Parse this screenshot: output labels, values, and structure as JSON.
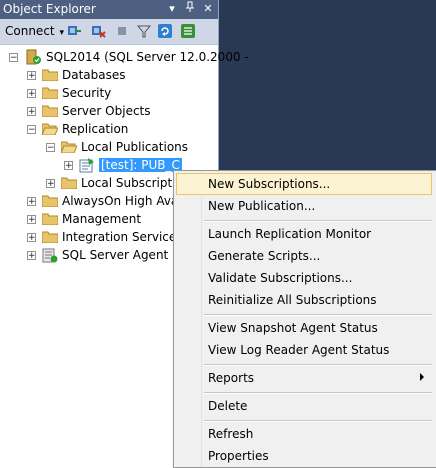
{
  "panel": {
    "title": "Object Explorer",
    "pin_icon": "pin-icon",
    "close_icon": "close-icon"
  },
  "toolbar": {
    "connect_label": "Connect",
    "icons": [
      "connect-server-icon",
      "disconnect-icon",
      "stop-icon",
      "filter-icon",
      "refresh-icon",
      "summary-icon"
    ]
  },
  "tree": {
    "server": "SQL2014 (SQL Server 12.0.2000 -",
    "databases": "Databases",
    "security": "Security",
    "server_objects": "Server Objects",
    "replication": "Replication",
    "local_publications": "Local Publications",
    "publication": "[test]: PUB_C",
    "local_subscriptions": "Local Subscriptio",
    "alwayson": "AlwaysOn High Avai",
    "management": "Management",
    "integration_services": "Integration Services C",
    "sql_server_agent": "SQL Server Agent"
  },
  "context_menu": {
    "new_subscriptions": "New Subscriptions...",
    "new_publication": "New Publication...",
    "launch_replication_monitor": "Launch Replication Monitor",
    "generate_scripts": "Generate Scripts...",
    "validate_subscriptions": "Validate Subscriptions...",
    "reinitialize_all": "Reinitialize All Subscriptions",
    "view_snapshot_agent": "View Snapshot Agent Status",
    "view_log_reader_agent": "View Log Reader Agent Status",
    "reports": "Reports",
    "delete": "Delete",
    "refresh": "Refresh",
    "properties": "Properties"
  },
  "colors": {
    "selection": "#3399ff",
    "menu_hover": "#fbf3d1",
    "title_bar": "#4d6082"
  }
}
